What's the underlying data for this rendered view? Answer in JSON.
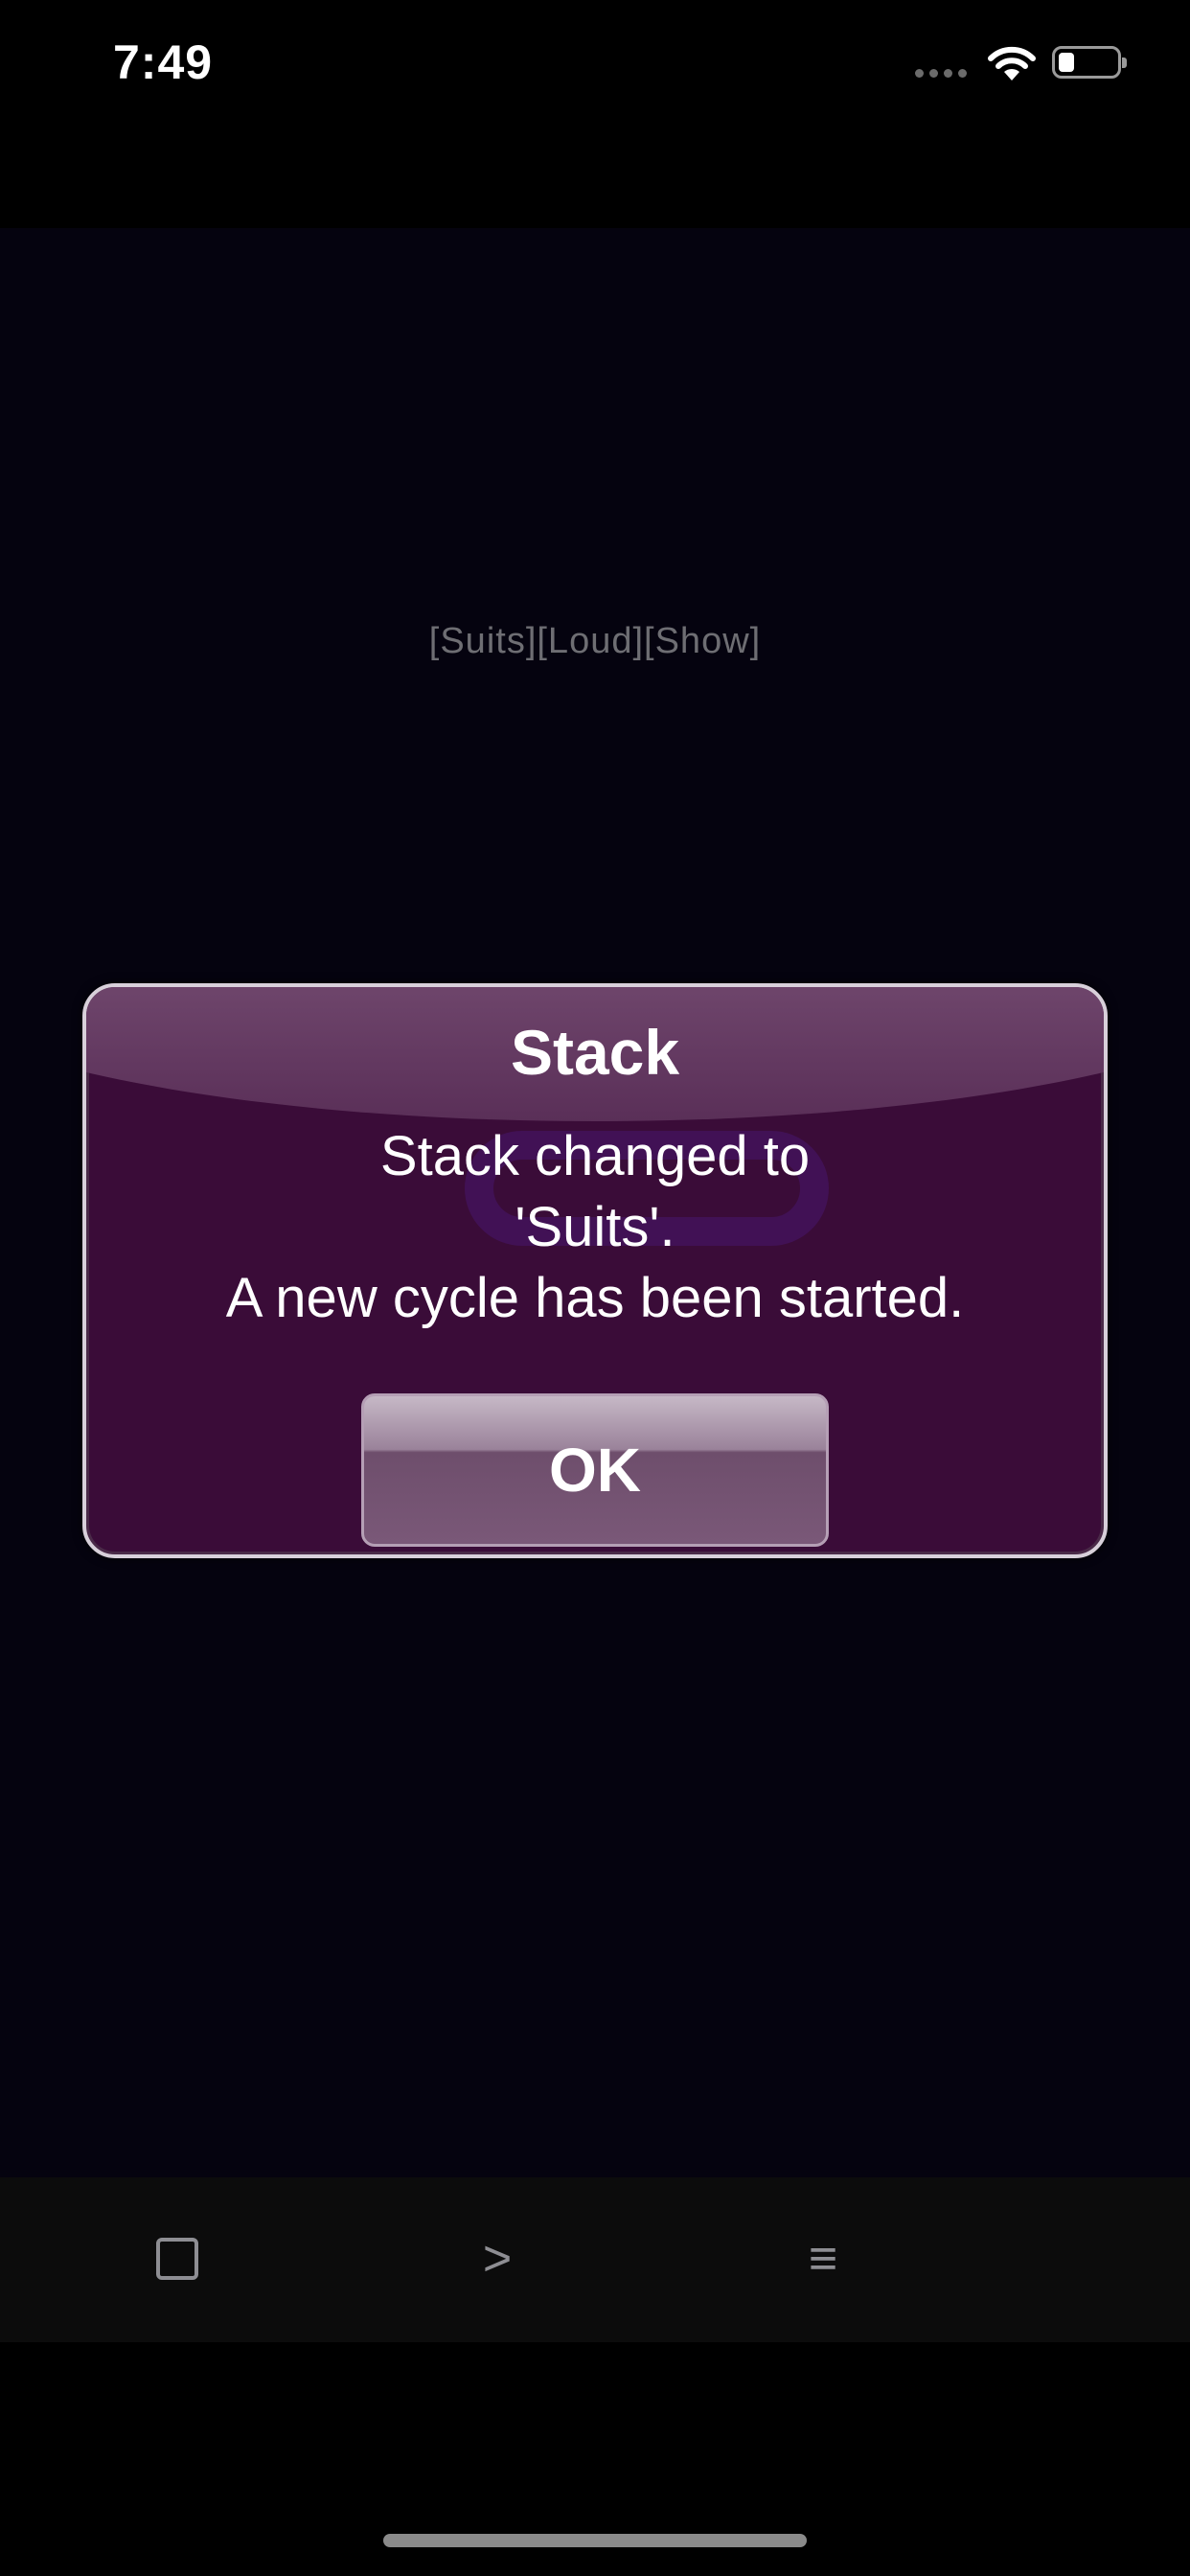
{
  "status_bar": {
    "time": "7:49"
  },
  "content": {
    "tags": "[Suits][Loud][Show]"
  },
  "dialog": {
    "title": "Stack",
    "message_line1": "Stack changed to",
    "message_line2": "'Suits'.",
    "message_line3": "A new cycle has been started.",
    "ok_label": "OK"
  },
  "toolbar": {
    "play_label": ">",
    "menu_label": "≡",
    "icons": [
      "square-icon",
      "play-icon",
      "menu-icon"
    ]
  }
}
